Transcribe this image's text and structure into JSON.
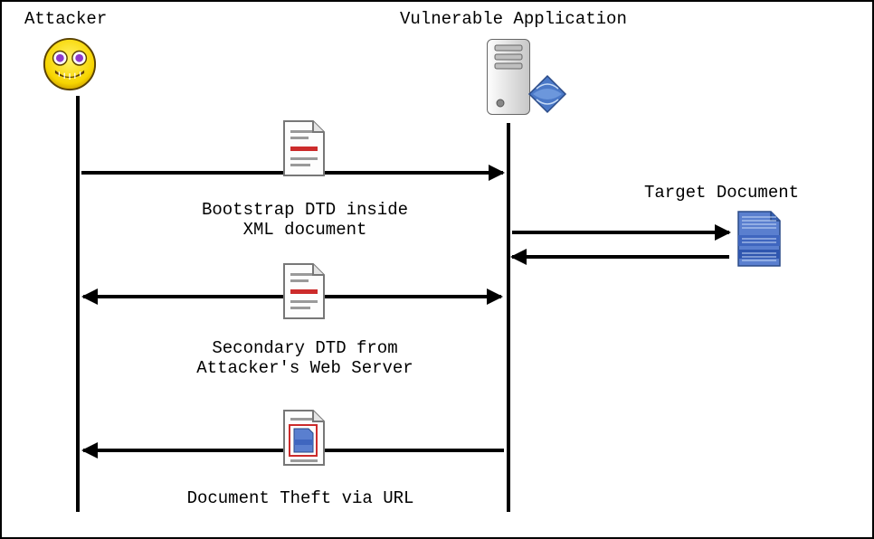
{
  "actors": {
    "attacker": "Attacker",
    "vulnerable_app": "Vulnerable Application",
    "target_doc": "Target Document"
  },
  "messages": {
    "m1": "Bootstrap DTD inside\nXML document",
    "m2": "Secondary DTD from\nAttacker's Web Server",
    "m3": "Document Theft via URL"
  }
}
